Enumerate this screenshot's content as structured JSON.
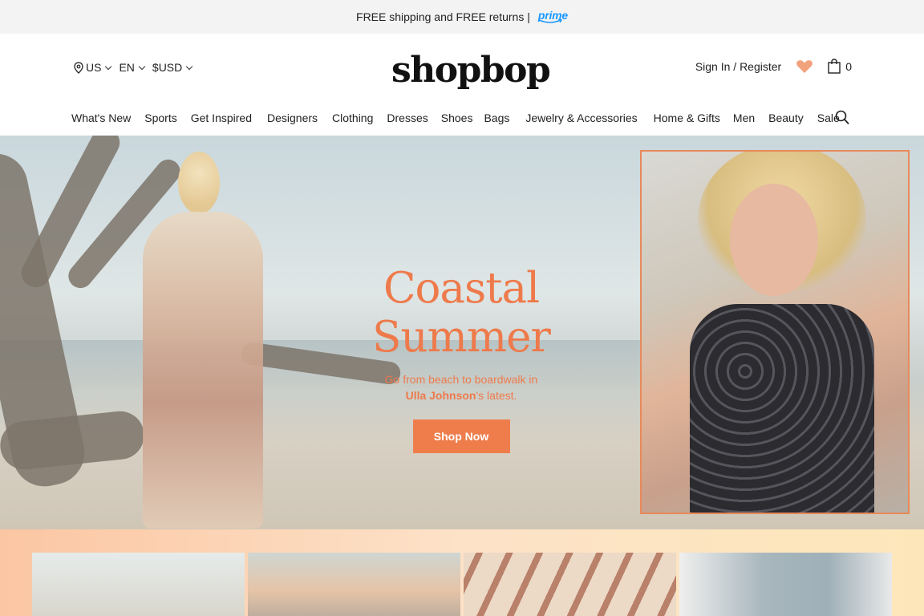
{
  "promo": {
    "text": "FREE shipping and FREE returns |",
    "prime_label": "prime",
    "prime_color": "#1a98ff"
  },
  "header": {
    "locale": {
      "country": "US",
      "language": "EN",
      "currency": "$USD"
    },
    "logo": "shopbop",
    "account": {
      "sign_in": "Sign In / Register",
      "bag_count": "0"
    }
  },
  "nav": {
    "items": [
      "What's New",
      "Sports",
      "Get Inspired",
      "Designers",
      "Clothing",
      "Dresses",
      "Shoes",
      "Bags",
      "Jewelry & Accessories",
      "Home & Gifts",
      "Men",
      "Beauty",
      "Sale"
    ],
    "search_icon": "search-icon"
  },
  "hero": {
    "title": "Coastal Summer",
    "subtitle_line1": "Go from beach to boardwalk in",
    "brand": "Ulla Johnson",
    "subtitle_line2_suffix": "'s latest.",
    "cta": "Shop Now"
  },
  "colors": {
    "accent": "#ef7d4c",
    "wishlist": "#f2a27c"
  },
  "icons": [
    "location-pin-icon",
    "heart-icon",
    "shopping-bag-icon",
    "search-icon",
    "chevron-down-icon"
  ]
}
